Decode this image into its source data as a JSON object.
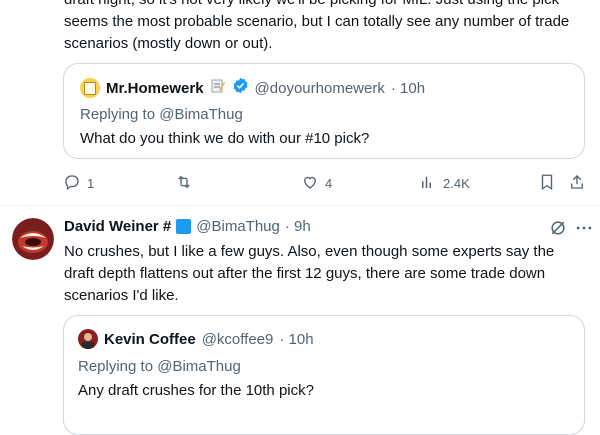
{
  "tweet1": {
    "text": "draft night, so it's not very likely we'll be picking for MIL. Just using the pick seems the most probable scenario, but I can totally see any number of trade scenarios (mostly down or out).",
    "quoted": {
      "author_name": "Mr.Homewerk",
      "author_handle": "@doyourhomewerk",
      "time": "· 10h",
      "replying_to": "Replying to @BimaThug",
      "text": "What do you think we do with our #10 pick?"
    },
    "actions": {
      "replies": "1",
      "retweets": "",
      "likes": "4",
      "views": "2.4K"
    }
  },
  "tweet2": {
    "author_name": "David Weiner #",
    "author_handle": "@BimaThug",
    "time": "· 9h",
    "text": "No crushes, but I like a few guys. Also, even though some experts say the draft depth flattens out after the first 12 guys, there are some trade down scenarios I'd like.",
    "quoted": {
      "author_name": "Kevin Coffee",
      "author_handle": "@kcoffee9",
      "time": "· 10h",
      "replying_to": "Replying to @BimaThug",
      "text": "Any draft crushes for the 10th pick?"
    }
  },
  "colors": {
    "text": "#0f1419",
    "muted": "#536471",
    "border": "#cfd9de",
    "verified": "#1d9bf0",
    "blue_square": "#1d9bf0"
  },
  "icons": [
    "memo-icon",
    "verified-badge-icon",
    "reply-icon",
    "retweet-icon",
    "like-icon",
    "views-icon",
    "bookmark-icon",
    "share-icon",
    "grok-icon",
    "more-icon"
  ]
}
